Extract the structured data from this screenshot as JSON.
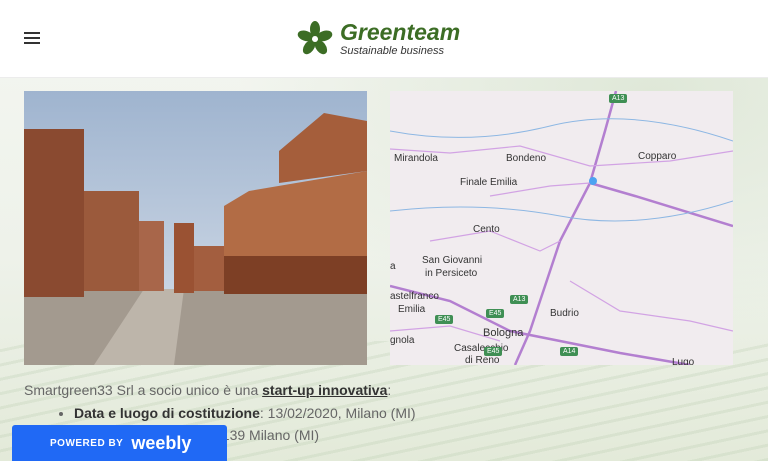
{
  "header": {
    "menu_icon": "hamburger-icon",
    "logo_icon": "clover-icon",
    "brand_title": "Greenteam",
    "brand_subtitle": "Sustainable business",
    "brand_color": "#3c6d25"
  },
  "map": {
    "labels": [
      "Mirandola",
      "Bondeno",
      "Copparo",
      "Finale Emilia",
      "Cento",
      "San Giovanni",
      "in Persiceto",
      "astelfranco",
      "Emilia",
      "Budrio",
      "Bologna",
      "Casalecchio",
      "di Reno",
      "gnola",
      "Lugo",
      "a"
    ],
    "road_badges": [
      "A13",
      "A13",
      "E45",
      "A14",
      "E45",
      "E45"
    ]
  },
  "content": {
    "intro_prefix": "Smartgreen33 Srl  a socio unico è una ",
    "intro_link": "start-up innovativa",
    "intro_suffix": ":",
    "items": [
      {
        "label": "Data e luogo di costituzione",
        "value": ": 13/02/2020, Milano (MI)"
      },
      {
        "label": "",
        "value": "0139 Milano (MI)"
      }
    ]
  },
  "footer_badge": {
    "prefix": "POWERED BY",
    "brand": "weebly",
    "color": "#2069f5"
  }
}
